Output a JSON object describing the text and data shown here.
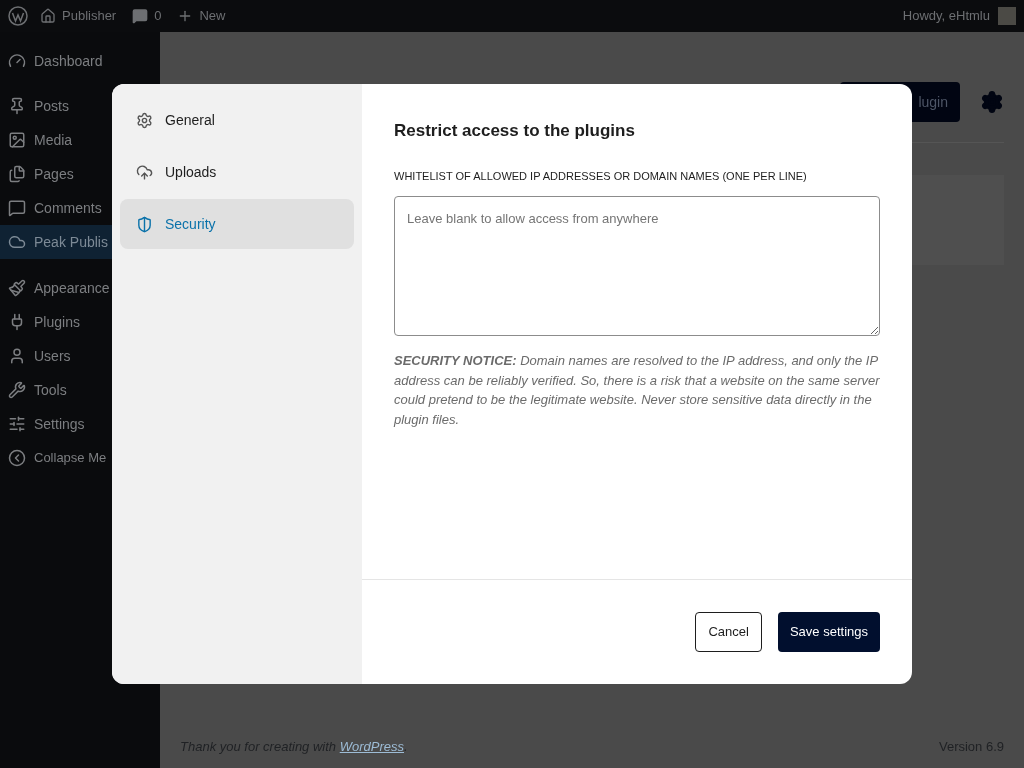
{
  "admin_bar": {
    "site": "Publisher",
    "comments": "0",
    "new": "New",
    "greeting": "Howdy, eHtmlu"
  },
  "sidebar": {
    "groups": [
      [
        {
          "label": "Dashboard",
          "selected": false
        }
      ],
      [
        {
          "label": "Posts",
          "selected": false
        },
        {
          "label": "Media",
          "selected": false
        },
        {
          "label": "Pages",
          "selected": false
        },
        {
          "label": "Comments",
          "selected": false
        },
        {
          "label": "Peak Publis",
          "selected": true
        }
      ],
      [
        {
          "label": "Appearance",
          "selected": false
        },
        {
          "label": "Plugins",
          "selected": false
        },
        {
          "label": "Users",
          "selected": false
        },
        {
          "label": "Tools",
          "selected": false
        },
        {
          "label": "Settings",
          "selected": false
        },
        {
          "label": "Collapse Me",
          "selected": false
        }
      ]
    ]
  },
  "page": {
    "action_button": "lugin"
  },
  "modal": {
    "nav": [
      {
        "label": "General",
        "selected": false
      },
      {
        "label": "Uploads",
        "selected": false
      },
      {
        "label": "Security",
        "selected": true
      }
    ],
    "title": "Restrict access to the plugins",
    "field_label": "WHITELIST OF ALLOWED IP ADDRESSES OR DOMAIN NAMES (ONE PER LINE)",
    "placeholder": "Leave blank to allow access from anywhere",
    "notice": "**SECURITY NOTICE:** Domain names are resolved to the IP address, and only the IP address can be reliably verified. So, there is a risk that a website on the same server could pretend to be the legitimate website. Never store sensitive data directly in the plugin files.",
    "buttons": {
      "cancel": "Cancel",
      "save": "Save settings"
    }
  },
  "footer": {
    "text": "Thank you for creating with",
    "link": "WordPress",
    "after": ".",
    "version": "Version 6.9"
  }
}
